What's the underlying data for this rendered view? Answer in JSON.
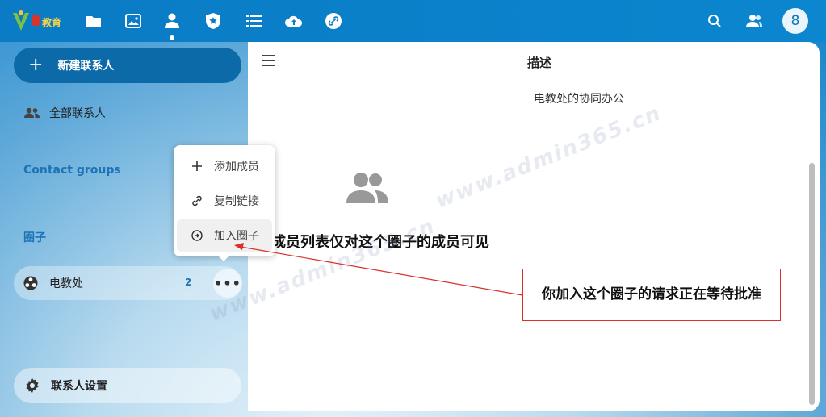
{
  "topbar": {
    "logo_text": "教育",
    "avatar_text": "8",
    "nav_icons": [
      "files-icon",
      "photos-icon",
      "contacts-icon",
      "deck-icon",
      "tasks-icon",
      "upload-icon",
      "link-icon"
    ],
    "right_icons": [
      "search-icon",
      "contacts-menu-icon"
    ],
    "accent": "#0082c9"
  },
  "sidebar": {
    "new_contact": "新建联系人",
    "all_contacts": "全部联系人",
    "groups_title": "Contact groups",
    "circles_title": "圈子",
    "circle": {
      "name": "电教处",
      "count": "2",
      "more": "•••"
    },
    "settings": "联系人设置"
  },
  "menu": {
    "items": [
      {
        "label": "添加成员",
        "icon": "plus-icon"
      },
      {
        "label": "复制链接",
        "icon": "link-icon"
      },
      {
        "label": "加入圈子",
        "icon": "join-icon"
      }
    ]
  },
  "main": {
    "empty_text": "成员列表仅对这个圈子的成员可见",
    "desc_title": "描述",
    "desc_value": "电教处的协同办公"
  },
  "annotation": {
    "text": "你加入这个圈子的请求正在等待批准",
    "color": "#d9302a"
  },
  "watermark": "www.admin365.cn"
}
